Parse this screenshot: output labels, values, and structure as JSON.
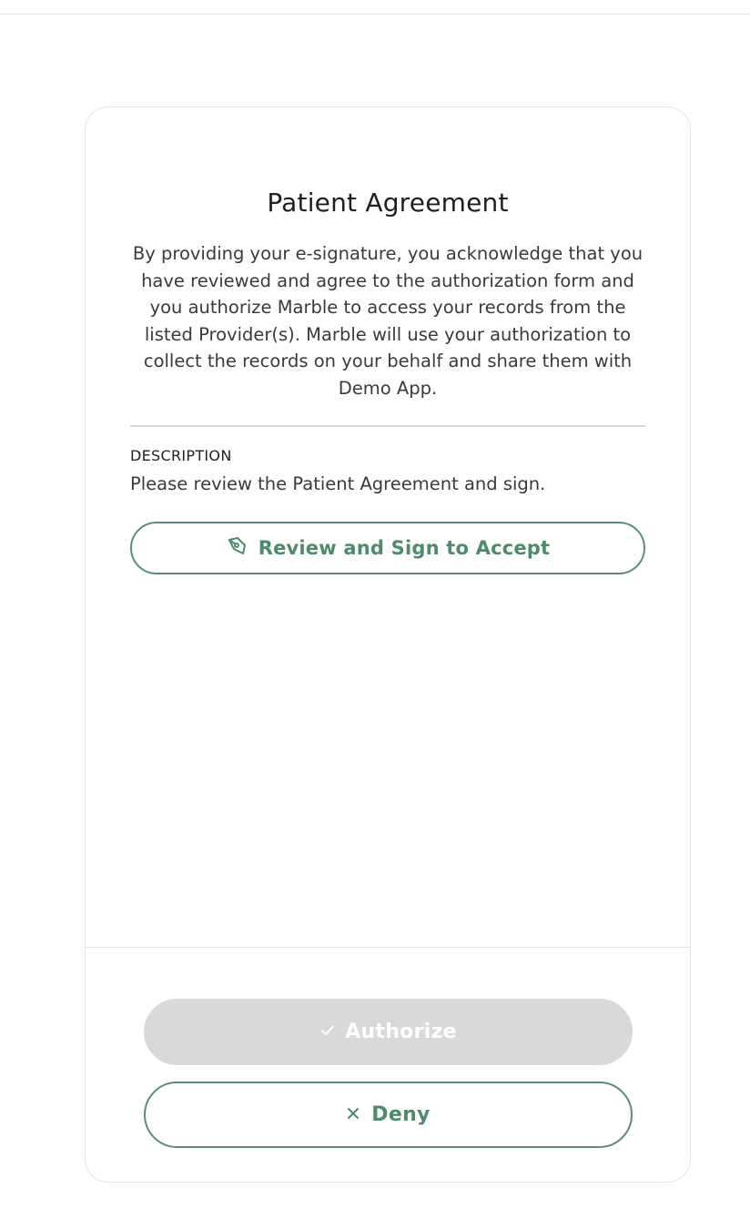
{
  "colors": {
    "accent": "#5a8f76",
    "accent_text": "#4e8a6d",
    "disabled_bg": "#d9d9d9",
    "border": "#e4e4e4"
  },
  "agreement": {
    "title": "Patient Agreement",
    "intro": "By providing your e-signature, you acknowledge that you have reviewed and agree to the authorization form and you authorize Marble to access your records from the listed Provider(s). Marble will use your authorization to collect the records on your behalf and share them with Demo App.",
    "description_label": "DESCRIPTION",
    "description_text": "Please review the Patient Agreement and sign.",
    "review_button": {
      "label": "Review and Sign to Accept",
      "icon": "pen-sign-icon"
    }
  },
  "actions": {
    "authorize": {
      "label": "Authorize",
      "icon": "check-icon",
      "disabled": true
    },
    "deny": {
      "label": "Deny",
      "icon": "close-icon"
    }
  }
}
